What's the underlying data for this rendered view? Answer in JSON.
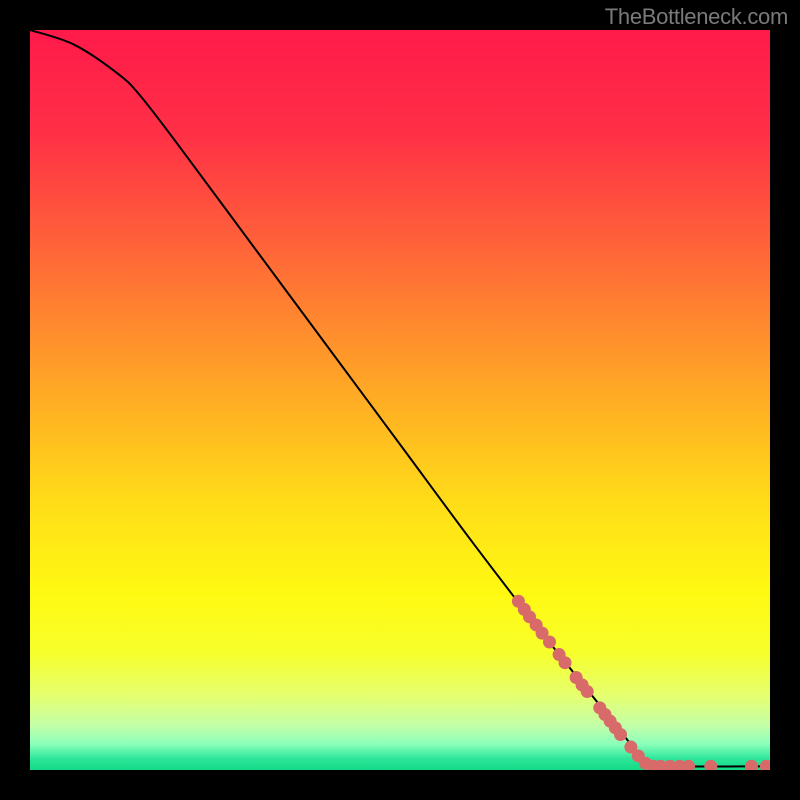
{
  "attribution": "TheBottleneck.com",
  "chart_data": {
    "type": "line",
    "title": "",
    "xlabel": "",
    "ylabel": "",
    "xlim": [
      0,
      100
    ],
    "ylim": [
      0,
      100
    ],
    "curve": [
      {
        "x": 0,
        "y": 100
      },
      {
        "x": 6,
        "y": 98
      },
      {
        "x": 12,
        "y": 94
      },
      {
        "x": 15,
        "y": 91
      },
      {
        "x": 20,
        "y": 84.5
      },
      {
        "x": 30,
        "y": 71
      },
      {
        "x": 40,
        "y": 57.5
      },
      {
        "x": 50,
        "y": 44
      },
      {
        "x": 60,
        "y": 30.5
      },
      {
        "x": 70,
        "y": 17.5
      },
      {
        "x": 80,
        "y": 5
      },
      {
        "x": 83,
        "y": 1
      },
      {
        "x": 84,
        "y": 0.5
      },
      {
        "x": 100,
        "y": 0.5
      }
    ],
    "scatter": [
      {
        "x": 66.0,
        "y": 22.8
      },
      {
        "x": 66.8,
        "y": 21.7
      },
      {
        "x": 67.5,
        "y": 20.7
      },
      {
        "x": 68.4,
        "y": 19.6
      },
      {
        "x": 69.2,
        "y": 18.5
      },
      {
        "x": 70.2,
        "y": 17.3
      },
      {
        "x": 71.5,
        "y": 15.6
      },
      {
        "x": 72.3,
        "y": 14.5
      },
      {
        "x": 73.8,
        "y": 12.5
      },
      {
        "x": 74.6,
        "y": 11.5
      },
      {
        "x": 75.3,
        "y": 10.6
      },
      {
        "x": 77.0,
        "y": 8.4
      },
      {
        "x": 77.7,
        "y": 7.5
      },
      {
        "x": 78.4,
        "y": 6.6
      },
      {
        "x": 79.1,
        "y": 5.7
      },
      {
        "x": 79.8,
        "y": 4.8
      },
      {
        "x": 81.2,
        "y": 3.1
      },
      {
        "x": 82.2,
        "y": 1.9
      },
      {
        "x": 83.2,
        "y": 0.9
      },
      {
        "x": 84.2,
        "y": 0.5
      },
      {
        "x": 85.2,
        "y": 0.5
      },
      {
        "x": 86.5,
        "y": 0.5
      },
      {
        "x": 87.8,
        "y": 0.5
      },
      {
        "x": 89.0,
        "y": 0.5
      },
      {
        "x": 92.0,
        "y": 0.5
      },
      {
        "x": 97.5,
        "y": 0.5
      },
      {
        "x": 99.5,
        "y": 0.5
      }
    ],
    "gradient_stops": [
      {
        "p": 0.0,
        "c": "#ff1a4a"
      },
      {
        "p": 0.14,
        "c": "#ff3046"
      },
      {
        "p": 0.28,
        "c": "#ff5f3a"
      },
      {
        "p": 0.4,
        "c": "#ff8a2e"
      },
      {
        "p": 0.52,
        "c": "#ffb422"
      },
      {
        "p": 0.64,
        "c": "#ffdd18"
      },
      {
        "p": 0.76,
        "c": "#fff912"
      },
      {
        "p": 0.84,
        "c": "#f7ff2a"
      },
      {
        "p": 0.9,
        "c": "#e5ff70"
      },
      {
        "p": 0.94,
        "c": "#c3ffa8"
      },
      {
        "p": 0.965,
        "c": "#8affba"
      },
      {
        "p": 0.985,
        "c": "#2ce69a"
      },
      {
        "p": 1.0,
        "c": "#15d985"
      }
    ],
    "scatter_color": "#d86a6a",
    "line_color": "#000000"
  }
}
